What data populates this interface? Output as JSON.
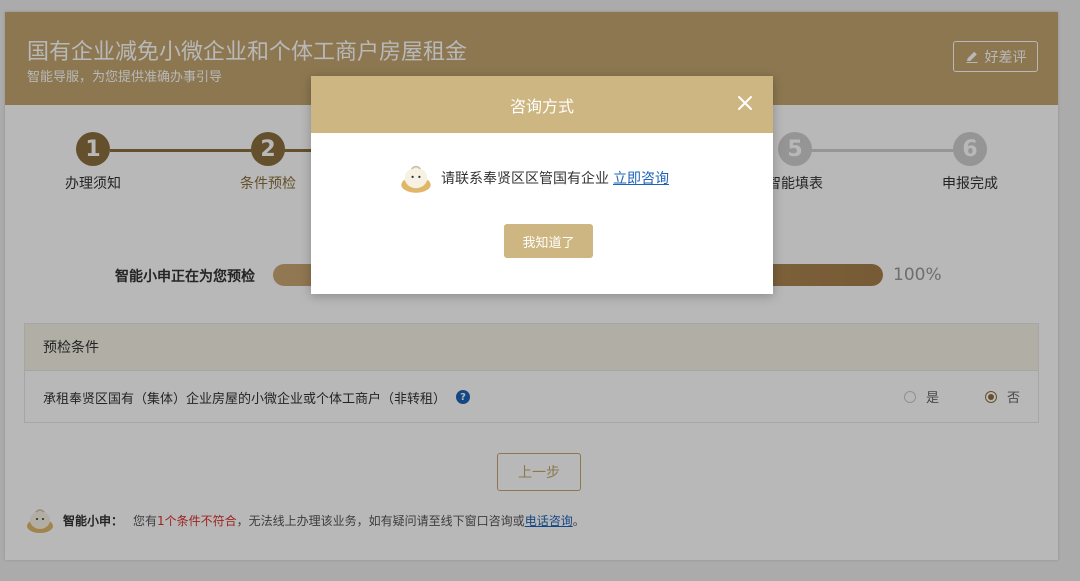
{
  "header": {
    "title": "国有企业减免小微企业和个体工商户房屋租金",
    "subtitle": "智能导服，为您提供准确办事引导",
    "rate_label": "好差评"
  },
  "steps": [
    {
      "number": "1",
      "label": "办理须知",
      "state": "done"
    },
    {
      "number": "2",
      "label": "条件预检",
      "state": "current"
    },
    {
      "number": "5",
      "label": "智能填表",
      "state": "pending"
    },
    {
      "number": "6",
      "label": "申报完成",
      "state": "pending"
    }
  ],
  "progress": {
    "label": "智能小申正在为您预检",
    "value": 100,
    "value_text": "100%"
  },
  "conditions": {
    "header": "预检条件",
    "rows": [
      {
        "text": "承租奉贤区国有（集体）企业房屋的小微企业或个体工商户（非转租）",
        "help_icon": "?",
        "options": [
          {
            "label": "是",
            "checked": false
          },
          {
            "label": "否",
            "checked": true
          }
        ]
      }
    ]
  },
  "buttons": {
    "prev": "上一步"
  },
  "notice": {
    "name": "智能小申：",
    "prefix": "您有",
    "warn": "1个条件不符合",
    "middle": "，无法线上办理该业务，如有疑问请至线下窗口咨询或",
    "link": "电话咨询",
    "suffix": "。"
  },
  "dialog": {
    "title": "咨询方式",
    "message": "请联系奉贤区区管国有企业",
    "link": "立即咨询",
    "ok": "我知道了"
  },
  "colors": {
    "brand": "#c2a56f",
    "brand_dark": "#8b6f3e",
    "dialog_header": "#cdb681",
    "warn": "#d9302c",
    "link": "#1e63b8"
  },
  "icons": {
    "rate": "pencil-icon",
    "help": "help-icon",
    "mascot": "mascot-icon",
    "close": "close-icon"
  }
}
